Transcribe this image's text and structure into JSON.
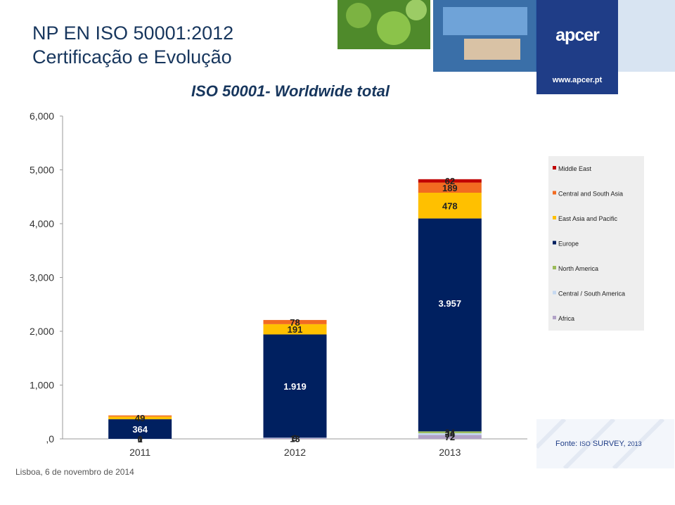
{
  "slide": {
    "title_line1": "NP EN ISO 50001:2012",
    "title_line2": "Certificação e Evolução",
    "footer": "Lisboa, 6 de novembro de 2014",
    "source_prefix": "Fonte: ",
    "source_iso": "ISO",
    "source_survey": " SURVEY, ",
    "source_year": "2013"
  },
  "logo": {
    "name": "apcer",
    "url": "www.apcer.pt"
  },
  "chart_data": {
    "type": "bar",
    "stacked": true,
    "title": "ISO 50001- Worldwide total",
    "categories": [
      "2011",
      "2012",
      "2013"
    ],
    "ylim": [
      0,
      6000
    ],
    "yticks": [
      0,
      1000,
      2000,
      3000,
      4000,
      5000,
      6000
    ],
    "ytick_labels": [
      ",0",
      "1,000",
      "2,000",
      "3,000",
      "4,000",
      "5,000",
      "6,000"
    ],
    "legend_position": "right",
    "series": [
      {
        "name": "Africa",
        "color": "#b2a2c7",
        "values": [
          0,
          13,
          72
        ],
        "labels": [
          "0",
          "13",
          "72"
        ]
      },
      {
        "name": "Central / South America",
        "color": "#c6d9f1",
        "values": [
          1,
          9,
          34
        ],
        "labels": [
          "1",
          "9",
          "34"
        ]
      },
      {
        "name": "North America",
        "color": "#9bbb59",
        "values": [
          0,
          0,
          34
        ],
        "labels": [
          "",
          "",
          "34"
        ]
      },
      {
        "name": "Europe",
        "color": "#002060",
        "values": [
          364,
          1919,
          3957
        ],
        "labels": [
          "364",
          "1.919",
          "3.957"
        ]
      },
      {
        "name": "East Asia and Pacific",
        "color": "#ffc000",
        "values": [
          49,
          191,
          478
        ],
        "labels": [
          "49",
          "191",
          "478"
        ]
      },
      {
        "name": "Central and South Asia",
        "color": "#f26b21",
        "values": [
          22,
          78,
          189
        ],
        "labels": [
          "",
          "78",
          "189"
        ]
      },
      {
        "name": "Middle East",
        "color": "#c00000",
        "values": [
          0,
          0,
          62
        ],
        "labels": [
          "",
          "",
          "62"
        ]
      }
    ],
    "legend_order": [
      "Middle East",
      "Central and South Asia",
      "East Asia and Pacific",
      "Europe",
      "North America",
      "Central / South America",
      "Africa"
    ]
  }
}
